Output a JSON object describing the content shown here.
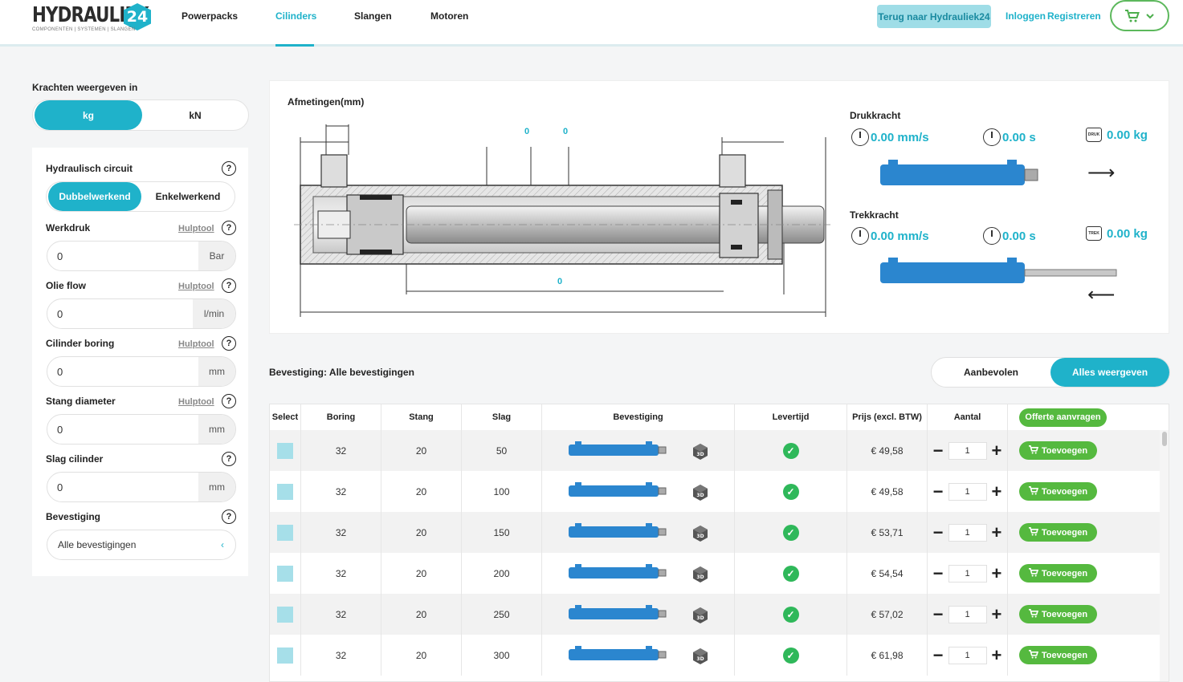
{
  "header": {
    "logo_text": "HYDRAULIEK",
    "logo_number": "24",
    "logo_subtitle": "COMPONENTEN | SYSTEMEN | SLANGEN",
    "nav": [
      "Powerpacks",
      "Cilinders",
      "Slangen",
      "Motoren"
    ],
    "active_nav": "Cilinders",
    "back_label": "Terug naar Hydrauliek24",
    "login_label": "Inloggen",
    "register_label": "Registreren",
    "cart_icon": "cart-icon",
    "colors": {
      "accent": "#1fb2ca",
      "green": "#55b93f"
    }
  },
  "left": {
    "force_title": "Krachten weergeven in",
    "force_options": [
      "kg",
      "kN"
    ],
    "force_selected": "kg",
    "circuit_label": "Hydraulisch circuit",
    "circuit_options": [
      "Dubbelwerkend",
      "Enkelwerkend"
    ],
    "circuit_selected": "Dubbelwerkend",
    "hulptool": "Hulptool",
    "fields": [
      {
        "label": "Werkdruk",
        "value": "0",
        "unit": "Bar",
        "hulptool": true
      },
      {
        "label": "Olie flow",
        "value": "0",
        "unit": "l/min",
        "hulptool": true
      },
      {
        "label": "Cilinder boring",
        "value": "0",
        "unit": "mm",
        "hulptool": true
      },
      {
        "label": "Stang diameter",
        "value": "0",
        "unit": "mm",
        "hulptool": true
      },
      {
        "label": "Slag cilinder",
        "value": "0",
        "unit": "mm",
        "hulptool": false
      }
    ],
    "mount_label": "Bevestiging",
    "mount_value": "Alle bevestigingen"
  },
  "diagram": {
    "title": "Afmetingen(mm)",
    "dim_top_1": "0",
    "dim_top_2": "0",
    "dim_bottom": "0"
  },
  "forces": {
    "push": {
      "title": "Drukkracht",
      "speed": "0.00 mm/s",
      "time": "0.00 s",
      "force": "0.00 kg"
    },
    "pull": {
      "title": "Trekkracht",
      "speed": "0.00 mm/s",
      "time": "0.00 s",
      "force": "0.00 kg"
    }
  },
  "mounting": {
    "label": "Bevestiging: Alle bevestigingen",
    "options": [
      "Aanbevolen",
      "Alles weergeven"
    ],
    "selected": "Alles weergeven"
  },
  "table": {
    "headers": [
      "Select",
      "Boring",
      "Stang",
      "Slag",
      "Bevestiging",
      "Levertijd",
      "Prijs (excl. BTW)",
      "Aantal"
    ],
    "quote_label": "Offerte aanvragen",
    "add_label": "Toevoegen",
    "rows": [
      {
        "boring": "32",
        "stang": "20",
        "slag": "50",
        "price": "€ 49,58",
        "qty": "1"
      },
      {
        "boring": "32",
        "stang": "20",
        "slag": "100",
        "price": "€ 49,58",
        "qty": "1"
      },
      {
        "boring": "32",
        "stang": "20",
        "slag": "150",
        "price": "€ 53,71",
        "qty": "1"
      },
      {
        "boring": "32",
        "stang": "20",
        "slag": "200",
        "price": "€ 54,54",
        "qty": "1"
      },
      {
        "boring": "32",
        "stang": "20",
        "slag": "250",
        "price": "€ 57,02",
        "qty": "1"
      },
      {
        "boring": "32",
        "stang": "20",
        "slag": "300",
        "price": "€ 61,98",
        "qty": "1"
      }
    ]
  }
}
